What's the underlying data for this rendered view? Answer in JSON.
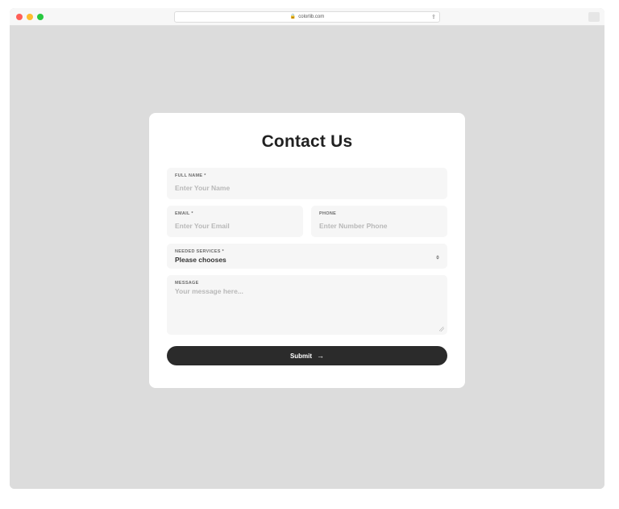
{
  "browser": {
    "url": "colorlib.com"
  },
  "form": {
    "heading": "Contact Us",
    "full_name": {
      "label": "FULL NAME *",
      "placeholder": "Enter Your Name"
    },
    "email": {
      "label": "EMAIL *",
      "placeholder": "Enter Your Email"
    },
    "phone": {
      "label": "PHONE",
      "placeholder": "Enter Number Phone"
    },
    "services": {
      "label": "NEEDED SERVICES *",
      "selected": "Please chooses"
    },
    "message": {
      "label": "MESSAGE",
      "placeholder": "Your message here..."
    },
    "submit_label": "Submit"
  }
}
